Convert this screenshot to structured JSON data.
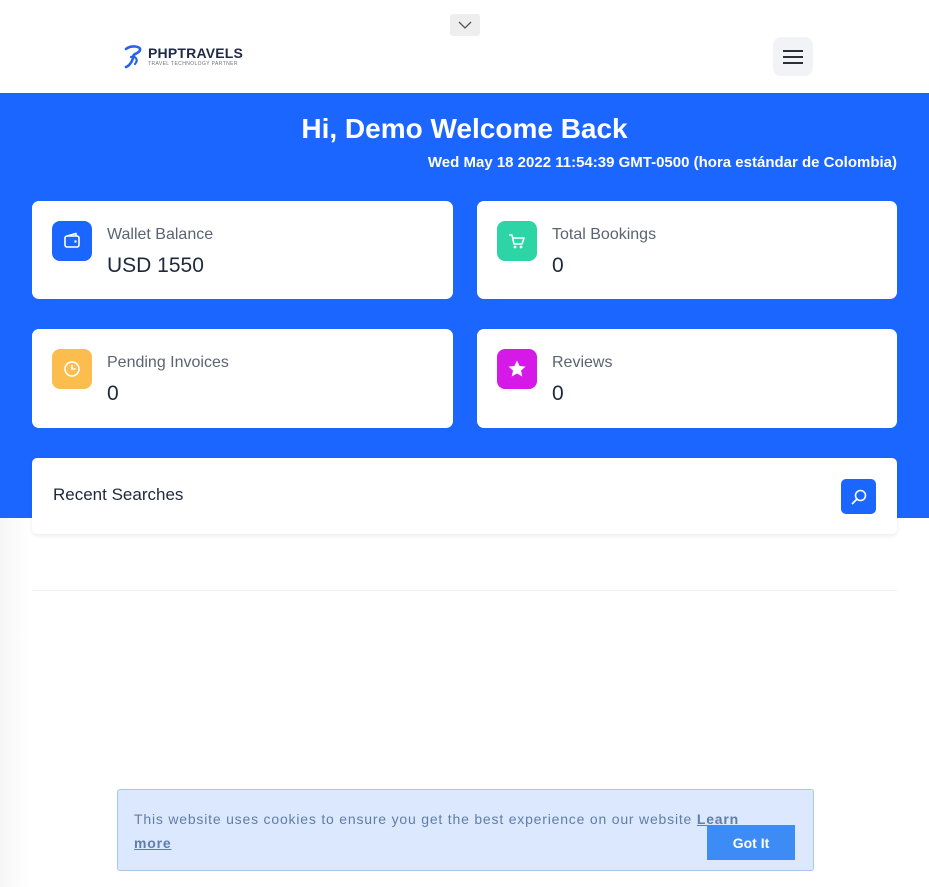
{
  "brand": {
    "name": "PHPTRAVELS",
    "tagline": "TRAVEL TECHNOLOGY PARTNER"
  },
  "icons": {
    "toggle": "chevron-down-icon",
    "menu": "hamburger-menu-icon",
    "search": "search-icon",
    "wallet": "wallet-icon",
    "cart": "cart-icon",
    "clock": "clock-icon",
    "star": "star-icon"
  },
  "header": {
    "greeting": "Hi, Demo Welcome Back",
    "datetime": "Wed May 18 2022 11:54:39 GMT-0500 (hora estándar de Colombia)"
  },
  "stats": [
    {
      "label": "Wallet Balance",
      "value": "USD 1550",
      "icon": "wallet-icon",
      "color": "#1a66ff"
    },
    {
      "label": "Total Bookings",
      "value": "0",
      "icon": "cart-icon",
      "color": "#2dd4a6"
    },
    {
      "label": "Pending Invoices",
      "value": "0",
      "icon": "clock-icon",
      "color": "#fbbd4e"
    },
    {
      "label": "Reviews",
      "value": "0",
      "icon": "star-icon",
      "color": "#d51ae8"
    }
  ],
  "recent": {
    "title": "Recent Searches"
  },
  "cookie": {
    "text": "This website uses cookies to ensure you get the best experience on our website",
    "link": "Learn more",
    "button": "Got It"
  },
  "colors": {
    "hero": "#1a66ff",
    "cookie_bg": "#dce8fd",
    "cookie_button": "#3d8bf4"
  }
}
